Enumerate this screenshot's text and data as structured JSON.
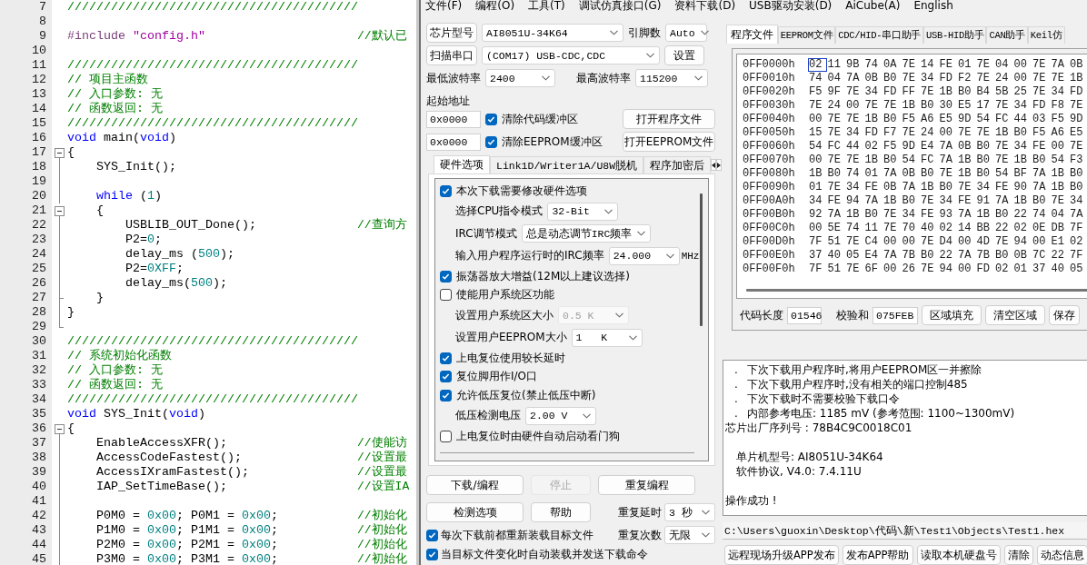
{
  "editor": {
    "lines": [
      {
        "number": "7",
        "fold_box": false,
        "fold_line": false,
        "fold_end": false,
        "tokens": [
          {
            "kind": "comment",
            "text": "////////////////////////////////////////"
          }
        ]
      },
      {
        "number": "8",
        "fold_box": false,
        "fold_line": false,
        "fold_end": false
      },
      {
        "number": "9",
        "fold_box": false,
        "fold_line": false,
        "fold_end": false,
        "tokens": [
          {
            "kind": "preprocessor",
            "text": "#include"
          },
          {
            "kind": "string",
            "text": " \"config.h\""
          }
        ],
        "note": "//默认已"
      },
      {
        "number": "10",
        "fold_box": false,
        "fold_line": false,
        "fold_end": false
      },
      {
        "number": "11",
        "fold_box": false,
        "fold_line": false,
        "fold_end": false,
        "tokens": [
          {
            "kind": "comment",
            "text": "////////////////////////////////////////"
          }
        ]
      },
      {
        "number": "12",
        "fold_box": false,
        "fold_line": false,
        "fold_end": false,
        "tokens": [
          {
            "kind": "comment",
            "text": "// 项目主函数"
          }
        ]
      },
      {
        "number": "13",
        "fold_box": false,
        "fold_line": false,
        "fold_end": false,
        "tokens": [
          {
            "kind": "comment",
            "text": "// 入口参数: 无"
          }
        ]
      },
      {
        "number": "14",
        "fold_box": false,
        "fold_line": false,
        "fold_end": false,
        "tokens": [
          {
            "kind": "comment",
            "text": "// 函数返回: 无"
          }
        ]
      },
      {
        "number": "15",
        "fold_box": false,
        "fold_line": false,
        "fold_end": false,
        "tokens": [
          {
            "kind": "comment",
            "text": "////////////////////////////////////////"
          }
        ]
      },
      {
        "number": "16",
        "fold_box": false,
        "fold_line": false,
        "fold_end": false,
        "tokens": [
          {
            "kind": "keyword",
            "text": "void"
          },
          {
            "kind": "plain",
            "text": " main("
          },
          {
            "kind": "keyword",
            "text": "void"
          },
          {
            "kind": "plain",
            "text": ")"
          }
        ]
      },
      {
        "number": "17",
        "fold_box": true,
        "fold_line": false,
        "fold_end": false,
        "tokens": [
          {
            "kind": "plain",
            "text": "{"
          }
        ]
      },
      {
        "number": "18",
        "fold_box": false,
        "fold_line": true,
        "fold_end": false,
        "tokens": [
          {
            "kind": "plain",
            "text": "    SYS_Init();"
          }
        ]
      },
      {
        "number": "19",
        "fold_box": false,
        "fold_line": true,
        "fold_end": false
      },
      {
        "number": "20",
        "fold_box": false,
        "fold_line": true,
        "fold_end": false,
        "tokens": [
          {
            "kind": "keyword",
            "text": "    while"
          },
          {
            "kind": "plain",
            "text": " ("
          },
          {
            "kind": "number",
            "text": "1"
          },
          {
            "kind": "plain",
            "text": ")"
          }
        ]
      },
      {
        "number": "21",
        "fold_box": true,
        "fold_line": false,
        "fold_end": false,
        "tokens": [
          {
            "kind": "plain",
            "text": "    {"
          }
        ]
      },
      {
        "number": "22",
        "fold_box": false,
        "fold_line": true,
        "fold_end": false,
        "tokens": [
          {
            "kind": "plain",
            "text": "        USBLIB_OUT_Done();"
          }
        ],
        "note": "//查询方"
      },
      {
        "number": "23",
        "fold_box": false,
        "fold_line": true,
        "fold_end": false,
        "tokens": [
          {
            "kind": "plain",
            "text": "        P2="
          },
          {
            "kind": "number",
            "text": "0"
          },
          {
            "kind": "plain",
            "text": ";"
          }
        ]
      },
      {
        "number": "24",
        "fold_box": false,
        "fold_line": true,
        "fold_end": false,
        "tokens": [
          {
            "kind": "plain",
            "text": "        delay_ms ("
          },
          {
            "kind": "number",
            "text": "500"
          },
          {
            "kind": "plain",
            "text": ");"
          }
        ]
      },
      {
        "number": "25",
        "fold_box": false,
        "fold_line": true,
        "fold_end": false,
        "tokens": [
          {
            "kind": "plain",
            "text": "        P2="
          },
          {
            "kind": "number",
            "text": "0XFF"
          },
          {
            "kind": "plain",
            "text": ";"
          }
        ]
      },
      {
        "number": "26",
        "fold_box": false,
        "fold_line": true,
        "fold_end": false,
        "tokens": [
          {
            "kind": "plain",
            "text": "        delay_ms("
          },
          {
            "kind": "number",
            "text": "500"
          },
          {
            "kind": "plain",
            "text": ");"
          }
        ]
      },
      {
        "number": "27",
        "fold_box": false,
        "fold_line": true,
        "fold_end": true,
        "tokens": [
          {
            "kind": "plain",
            "text": "    }"
          }
        ]
      },
      {
        "number": "28",
        "fold_box": false,
        "fold_line": true,
        "fold_end": false,
        "tokens": [
          {
            "kind": "plain",
            "text": "}"
          }
        ]
      },
      {
        "number": "29",
        "fold_box": false,
        "fold_line": false,
        "fold_end": true
      },
      {
        "number": "30",
        "fold_box": false,
        "fold_line": false,
        "fold_end": false,
        "tokens": [
          {
            "kind": "comment",
            "text": "////////////////////////////////////////"
          }
        ]
      },
      {
        "number": "31",
        "fold_box": false,
        "fold_line": false,
        "fold_end": false,
        "tokens": [
          {
            "kind": "comment",
            "text": "// 系统初始化函数"
          }
        ]
      },
      {
        "number": "32",
        "fold_box": false,
        "fold_line": false,
        "fold_end": false,
        "tokens": [
          {
            "kind": "comment",
            "text": "// 入口参数: 无"
          }
        ]
      },
      {
        "number": "33",
        "fold_box": false,
        "fold_line": false,
        "fold_end": false,
        "tokens": [
          {
            "kind": "comment",
            "text": "// 函数返回: 无"
          }
        ]
      },
      {
        "number": "34",
        "fold_box": false,
        "fold_line": false,
        "fold_end": false,
        "tokens": [
          {
            "kind": "comment",
            "text": "////////////////////////////////////////"
          }
        ]
      },
      {
        "number": "35",
        "fold_box": false,
        "fold_line": false,
        "fold_end": false,
        "tokens": [
          {
            "kind": "keyword",
            "text": "void"
          },
          {
            "kind": "plain",
            "text": " SYS_Init("
          },
          {
            "kind": "keyword",
            "text": "void"
          },
          {
            "kind": "plain",
            "text": ")"
          }
        ]
      },
      {
        "number": "36",
        "fold_box": true,
        "fold_line": false,
        "fold_end": false,
        "tokens": [
          {
            "kind": "plain",
            "text": "{"
          }
        ]
      },
      {
        "number": "37",
        "fold_box": false,
        "fold_line": true,
        "fold_end": false,
        "tokens": [
          {
            "kind": "plain",
            "text": "    EnableAccessXFR();"
          }
        ],
        "note": "//使能访"
      },
      {
        "number": "38",
        "fold_box": false,
        "fold_line": true,
        "fold_end": false,
        "tokens": [
          {
            "kind": "plain",
            "text": "    AccessCodeFastest();"
          }
        ],
        "note": "//设置最"
      },
      {
        "number": "39",
        "fold_box": false,
        "fold_line": true,
        "fold_end": false,
        "tokens": [
          {
            "kind": "plain",
            "text": "    AccessIXramFastest();"
          }
        ],
        "note": "//设置最"
      },
      {
        "number": "40",
        "fold_box": false,
        "fold_line": true,
        "fold_end": false,
        "tokens": [
          {
            "kind": "plain",
            "text": "    IAP_SetTimeBase();"
          }
        ],
        "note": "//设置IA"
      },
      {
        "number": "41",
        "fold_box": false,
        "fold_line": true,
        "fold_end": false
      },
      {
        "number": "42",
        "fold_box": false,
        "fold_line": true,
        "fold_end": false,
        "tokens": [
          {
            "kind": "plain",
            "text": "    P0M0 = "
          },
          {
            "kind": "number",
            "text": "0x00"
          },
          {
            "kind": "plain",
            "text": "; P0M1 = "
          },
          {
            "kind": "number",
            "text": "0x00"
          },
          {
            "kind": "plain",
            "text": ";"
          }
        ],
        "note": "//初始化"
      },
      {
        "number": "43",
        "fold_box": false,
        "fold_line": true,
        "fold_end": false,
        "tokens": [
          {
            "kind": "plain",
            "text": "    P1M0 = "
          },
          {
            "kind": "number",
            "text": "0x00"
          },
          {
            "kind": "plain",
            "text": "; P1M1 = "
          },
          {
            "kind": "number",
            "text": "0x00"
          },
          {
            "kind": "plain",
            "text": ";"
          }
        ],
        "note": "//初始化"
      },
      {
        "number": "44",
        "fold_box": false,
        "fold_line": true,
        "fold_end": false,
        "tokens": [
          {
            "kind": "plain",
            "text": "    P2M0 = "
          },
          {
            "kind": "number",
            "text": "0x00"
          },
          {
            "kind": "plain",
            "text": "; P2M1 = "
          },
          {
            "kind": "number",
            "text": "0x00"
          },
          {
            "kind": "plain",
            "text": ";"
          }
        ],
        "note": "//初始化"
      },
      {
        "number": "45",
        "fold_box": false,
        "fold_line": true,
        "fold_end": false,
        "tokens": [
          {
            "kind": "plain",
            "text": "    P3M0 = "
          },
          {
            "kind": "number",
            "text": "0x00"
          },
          {
            "kind": "plain",
            "text": "; P3M1 = "
          },
          {
            "kind": "number",
            "text": "0x00"
          },
          {
            "kind": "plain",
            "text": ";"
          }
        ],
        "note": "//初始化"
      }
    ]
  },
  "menu": [
    {
      "label": "文件(F)"
    },
    {
      "label": "编程(O)"
    },
    {
      "label": "工具(T)"
    },
    {
      "label": "调试仿真接口(G)"
    },
    {
      "label": "资料下载(D)"
    },
    {
      "label": "USB驱动安装(D)"
    },
    {
      "label": "AiCube(A)"
    },
    {
      "label": "English"
    }
  ],
  "chip": {
    "chip_button": "芯片型号",
    "chip_model": "AI8051U-34K64",
    "pins_label": "引脚数",
    "pins": "Auto",
    "scan_button": "扫描串口",
    "port": "(COM17) USB-CDC,CDC",
    "settings_button": "设置",
    "min_baud_label": "最低波特率",
    "min_baud": "2400",
    "max_baud_label": "最高波特率",
    "max_baud": "115200",
    "start_address_label": "起始地址",
    "code_address": "0x0000",
    "clear_code": {
      "label": "清除代码缓冲区",
      "checked": true
    },
    "open_program_button": "打开程序文件",
    "eeprom_address": "0x0000",
    "clear_eeprom": {
      "label": "清除EEPROM缓冲区",
      "checked": true
    },
    "open_eeprom_button": "打开EEPROM文件"
  },
  "option_tabs": [
    {
      "label": "硬件选项",
      "selected": true
    },
    {
      "label": "Link1D/Writer1A/U8W脱机",
      "selected": false
    },
    {
      "label": "程序加密后",
      "selected": false
    }
  ],
  "hardware_options": [
    {
      "kind": "checkbox",
      "label": "本次下载需要修改硬件选项",
      "checked": true
    },
    {
      "kind": "select",
      "label": "选择CPU指令模式",
      "value": "32-Bit",
      "disabled": false
    },
    {
      "kind": "select",
      "label": "IRC调节模式",
      "value": "总是动态调节IRC频率",
      "disabled": false
    },
    {
      "kind": "select",
      "label": "输入用户程序运行时的IRC频率",
      "value": "24.000",
      "unit": "MHz",
      "disabled": false
    },
    {
      "kind": "checkbox",
      "label": "振荡器放大增益(12M以上建议选择)",
      "checked": true
    },
    {
      "kind": "checkbox",
      "label": "使能用户系统区功能",
      "checked": false
    },
    {
      "kind": "select",
      "label": "设置用户系统区大小",
      "value": "0.5 K",
      "disabled": true
    },
    {
      "kind": "select",
      "label": "设置用户EEPROM大小",
      "value": "1   K",
      "disabled": false
    },
    {
      "kind": "checkbox",
      "label": "上电复位使用较长延时",
      "checked": true
    },
    {
      "kind": "checkbox",
      "label": "复位脚用作I/O口",
      "checked": true
    },
    {
      "kind": "checkbox",
      "label": "允许低压复位(禁止低压中断)",
      "checked": true
    },
    {
      "kind": "select",
      "label": "低压检测电压",
      "value": "2.00 V",
      "disabled": false
    },
    {
      "kind": "checkbox",
      "label": "上电复位时由硬件自动启动看门狗",
      "checked": false
    }
  ],
  "actions": [
    {
      "label": "下载/编程",
      "disabled": false
    },
    {
      "label": "停止",
      "disabled": true
    },
    {
      "label": "重复编程",
      "disabled": false
    },
    {
      "label": "检测选项",
      "disabled": false
    },
    {
      "label": "帮助",
      "disabled": false
    }
  ],
  "repeat_delay": {
    "label": "重复延时",
    "value": "3 秒"
  },
  "repeat_count": {
    "label": "重复次数",
    "value": "无限"
  },
  "auto_options": [
    {
      "label": "每次下载前都重新装载目标文件",
      "checked": true
    },
    {
      "label": "当目标文件变化时自动装载并发送下载命令",
      "checked": true
    }
  ],
  "file_tabs": [
    {
      "label": "程序文件",
      "selected": true
    },
    {
      "label": "EEPROM文件",
      "selected": false
    },
    {
      "label": "CDC/HID-串口助手",
      "selected": false
    },
    {
      "label": "USB-HID助手",
      "selected": false
    },
    {
      "label": "CAN助手",
      "selected": false
    },
    {
      "label": "Keil仿",
      "selected": false
    }
  ],
  "hex": {
    "rows": [
      {
        "address": "0FF0000h",
        "cursor": true,
        "bytes": [
          "02",
          "11",
          "9B",
          "74",
          "0A",
          "7E",
          "14",
          "FE",
          "01",
          "7E",
          "04",
          "00",
          "7E",
          "7A",
          "0B"
        ]
      },
      {
        "address": "0FF0010h",
        "cursor": false,
        "bytes": [
          "74",
          "04",
          "7A",
          "0B",
          "B0",
          "7E",
          "34",
          "FD",
          "F2",
          "7E",
          "24",
          "00",
          "7E",
          "7E",
          "1B"
        ]
      },
      {
        "address": "0FF0020h",
        "cursor": false,
        "bytes": [
          "F5",
          "9F",
          "7E",
          "34",
          "FD",
          "FF",
          "7E",
          "1B",
          "B0",
          "B4",
          "5B",
          "25",
          "7E",
          "34",
          "FD"
        ]
      },
      {
        "address": "0FF0030h",
        "cursor": false,
        "bytes": [
          "7E",
          "24",
          "00",
          "7E",
          "7E",
          "1B",
          "B0",
          "30",
          "E5",
          "17",
          "7E",
          "34",
          "FD",
          "F8",
          "7E"
        ]
      },
      {
        "address": "0FF0040h",
        "cursor": false,
        "bytes": [
          "00",
          "7E",
          "7E",
          "1B",
          "B0",
          "F5",
          "A6",
          "E5",
          "9D",
          "54",
          "FC",
          "44",
          "03",
          "F5",
          "9D"
        ]
      },
      {
        "address": "0FF0050h",
        "cursor": false,
        "bytes": [
          "15",
          "7E",
          "34",
          "FD",
          "F7",
          "7E",
          "24",
          "00",
          "7E",
          "7E",
          "1B",
          "B0",
          "F5",
          "A6",
          "E5"
        ]
      },
      {
        "address": "0FF0060h",
        "cursor": false,
        "bytes": [
          "54",
          "FC",
          "44",
          "02",
          "F5",
          "9D",
          "E4",
          "7A",
          "0B",
          "B0",
          "7E",
          "34",
          "FE",
          "00",
          "7E"
        ]
      },
      {
        "address": "0FF0070h",
        "cursor": false,
        "bytes": [
          "00",
          "7E",
          "7E",
          "1B",
          "B0",
          "54",
          "FC",
          "7A",
          "1B",
          "B0",
          "7E",
          "1B",
          "B0",
          "54",
          "F3"
        ]
      },
      {
        "address": "0FF0080h",
        "cursor": false,
        "bytes": [
          "1B",
          "B0",
          "74",
          "01",
          "7A",
          "0B",
          "B0",
          "7E",
          "1B",
          "B0",
          "54",
          "BF",
          "7A",
          "1B",
          "B0"
        ]
      },
      {
        "address": "0FF0090h",
        "cursor": false,
        "bytes": [
          "01",
          "7E",
          "34",
          "FE",
          "0B",
          "7A",
          "1B",
          "B0",
          "7E",
          "34",
          "FE",
          "90",
          "7A",
          "1B",
          "B0"
        ]
      },
      {
        "address": "0FF00A0h",
        "cursor": false,
        "bytes": [
          "34",
          "FE",
          "94",
          "7A",
          "1B",
          "B0",
          "7E",
          "34",
          "FE",
          "91",
          "7A",
          "1B",
          "B0",
          "7E",
          "34"
        ]
      },
      {
        "address": "0FF00B0h",
        "cursor": false,
        "bytes": [
          "92",
          "7A",
          "1B",
          "B0",
          "7E",
          "34",
          "FE",
          "93",
          "7A",
          "1B",
          "B0",
          "22",
          "74",
          "04",
          "7A"
        ]
      },
      {
        "address": "0FF00C0h",
        "cursor": false,
        "bytes": [
          "00",
          "5E",
          "74",
          "11",
          "7E",
          "70",
          "40",
          "02",
          "14",
          "BB",
          "22",
          "02",
          "0E",
          "DB",
          "7F"
        ]
      },
      {
        "address": "0FF00D0h",
        "cursor": false,
        "bytes": [
          "7F",
          "51",
          "7E",
          "C4",
          "00",
          "00",
          "7E",
          "D4",
          "00",
          "4D",
          "7E",
          "94",
          "00",
          "E1",
          "02"
        ]
      },
      {
        "address": "0FF00E0h",
        "cursor": false,
        "bytes": [
          "37",
          "40",
          "05",
          "E4",
          "7A",
          "7B",
          "B0",
          "22",
          "7A",
          "7B",
          "B0",
          "0B",
          "7C",
          "22",
          "7F"
        ]
      },
      {
        "address": "0FF00F0h",
        "cursor": false,
        "bytes": [
          "7F",
          "51",
          "7E",
          "6F",
          "00",
          "26",
          "7E",
          "94",
          "00",
          "FD",
          "02",
          "01",
          "37",
          "40",
          "05"
        ]
      }
    ]
  },
  "summary": {
    "code_length_label": "代码长度",
    "code_length": "01546",
    "checksum_label": "校验和",
    "checksum": "075FEB",
    "buttons": [
      "区域填充",
      "清空区域",
      "保存"
    ]
  },
  "log": [
    {
      "kind": "bullet",
      "marker": ".",
      "text": "下次下载用户程序时,将用户EEPROM区一并擦除"
    },
    {
      "kind": "bullet",
      "marker": ".",
      "text": "下次下载用户程序时,没有相关的端口控制485"
    },
    {
      "kind": "bullet",
      "marker": ".",
      "text": "下次下载时不需要校验下载口令"
    },
    {
      "kind": "bullet",
      "marker": ".",
      "text": "内部参考电压: 1185 mV (参考范围: 1100~1300mV)"
    },
    {
      "kind": "plain",
      "text": "芯片出厂序列号 : 78B4C9C0018C01"
    },
    {
      "kind": "indented",
      "text": "单片机型号: AI8051U-34K64",
      "space_before": true
    },
    {
      "kind": "indented",
      "text": "软件协议, V4.0: 7.4.11U"
    },
    {
      "kind": "plain",
      "text": "操作成功 !",
      "space_before": true
    }
  ],
  "file_path": "C:\\Users\\guoxin\\Desktop\\代码\\新\\Test1\\Objects\\Test1.hex",
  "bottom_buttons": [
    "远程现场升级APP发布",
    "发布APP帮助",
    "读取本机硬盘号",
    "清除",
    "动态信息"
  ]
}
